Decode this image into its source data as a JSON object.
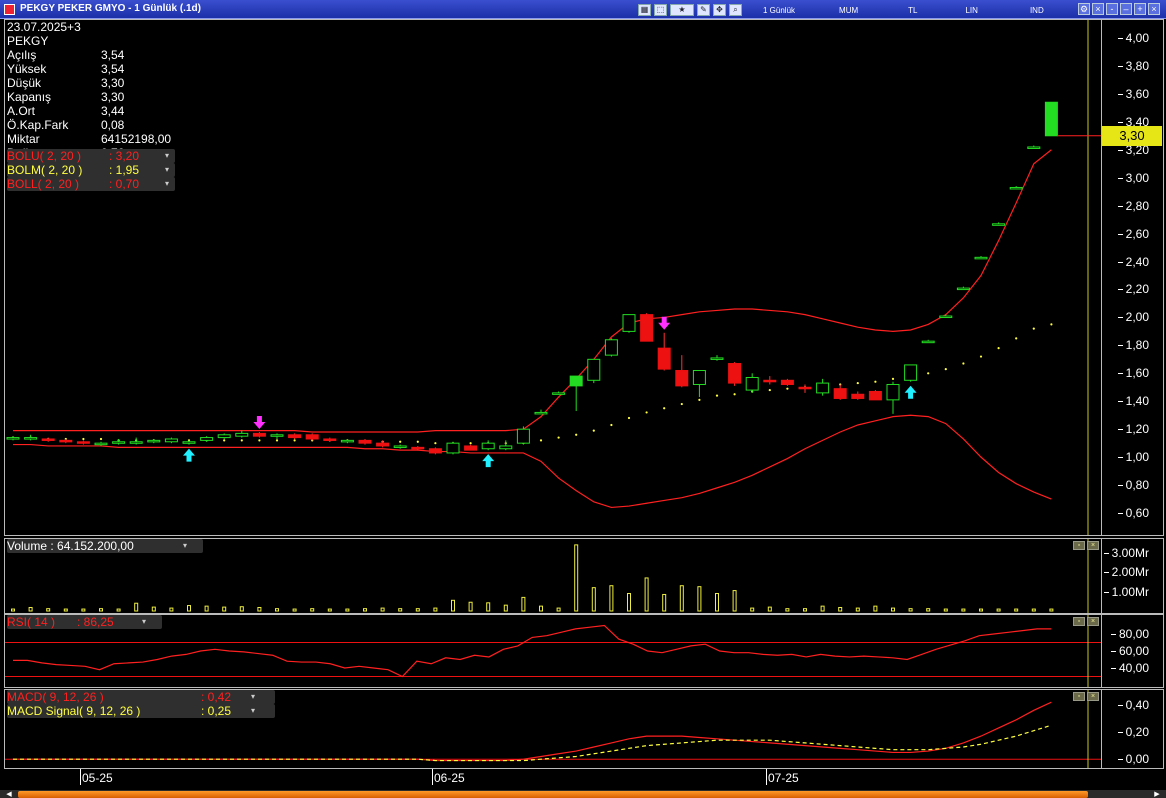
{
  "window": {
    "title": "PEKGY PEKER GMYO - 1 Günlük (.1d)",
    "toolbar": {
      "period_label": "1 Günlük",
      "chart_type": "MUM",
      "currency": "TL",
      "scale": "LIN",
      "indicator": "IND",
      "icons": [
        "toolbar-icon-1",
        "toolbar-icon-2",
        "favorites-icon",
        "draw-icon",
        "cursor-icon",
        "zoom-icon"
      ]
    },
    "buttons": [
      "settings-icon",
      "close-icon",
      "minimize-icon",
      "maximize-icon",
      "restore-icon",
      "close-window-icon"
    ]
  },
  "info": {
    "date": "23.07.2025+3",
    "symbol": "PEKGY",
    "rows": [
      {
        "k": "Açılış",
        "v": "3,54"
      },
      {
        "k": "Yüksek",
        "v": "3,54"
      },
      {
        "k": "Düşük",
        "v": "3,30"
      },
      {
        "k": "Kapanış",
        "v": "3,30"
      },
      {
        "k": "A.Ort",
        "v": "3,44"
      },
      {
        "k": "Ö.Kap.Fark",
        "v": "0,08"
      },
      {
        "k": "Miktar",
        "v": "64152198,00"
      },
      {
        "k": "Değer",
        "v": "0,76"
      }
    ]
  },
  "price_legend": [
    {
      "k": "BOLU( 2, 20 )",
      "v": ": 3,20",
      "color": "#ff2020"
    },
    {
      "k": "BOLM( 2, 20 )",
      "v": ": 1,95",
      "color": "#ffff40"
    },
    {
      "k": "BOLL( 2, 20 )",
      "v": ": 0,70",
      "color": "#ff2020"
    }
  ],
  "price_axis": [
    "4,00",
    "3,80",
    "3,60",
    "3,40",
    "3,20",
    "3,00",
    "2,80",
    "2,60",
    "2,40",
    "2,20",
    "2,00",
    "1,80",
    "1,60",
    "1,40",
    "1,20",
    "1,00",
    "0,80",
    "0,60"
  ],
  "last_price": "3,30",
  "volume": {
    "legend": "Volume : 64.152.200,00",
    "axis": [
      "3.00Mr",
      "2.00Mr",
      "1.00Mr"
    ]
  },
  "rsi": {
    "legend_k": "RSI( 14 )",
    "legend_v": ": 86,25",
    "axis": [
      "80,00",
      "60,00",
      "40,00"
    ]
  },
  "macd": {
    "legend": [
      {
        "k": "MACD( 9, 12, 26 )",
        "v": ": 0,42",
        "color": "#ff2020"
      },
      {
        "k": "MACD Signal( 9, 12, 26 )",
        "v": ": 0,25",
        "color": "#ffff40"
      }
    ],
    "axis": [
      "0,40",
      "0,20",
      "0,00"
    ]
  },
  "date_axis": [
    "05-25",
    "06-25",
    "07-25"
  ],
  "colors": {
    "up": "#22dd22",
    "down": "#ee1111",
    "boll": "#ff2020",
    "mid": "#ffff40",
    "volume": "#eeee40",
    "signal_up": "#20f0ff",
    "signal_down": "#ff30ff"
  },
  "chart_data": {
    "type": "candlestick",
    "candles": [
      {
        "o": 1.13,
        "h": 1.15,
        "l": 1.12,
        "c": 1.14
      },
      {
        "o": 1.13,
        "h": 1.16,
        "l": 1.12,
        "c": 1.14
      },
      {
        "o": 1.13,
        "h": 1.14,
        "l": 1.11,
        "c": 1.12
      },
      {
        "o": 1.12,
        "h": 1.13,
        "l": 1.1,
        "c": 1.11
      },
      {
        "o": 1.11,
        "h": 1.12,
        "l": 1.09,
        "c": 1.1
      },
      {
        "o": 1.09,
        "h": 1.11,
        "l": 1.08,
        "c": 1.1
      },
      {
        "o": 1.1,
        "h": 1.13,
        "l": 1.09,
        "c": 1.11
      },
      {
        "o": 1.1,
        "h": 1.14,
        "l": 1.09,
        "c": 1.11
      },
      {
        "o": 1.11,
        "h": 1.13,
        "l": 1.1,
        "c": 1.12
      },
      {
        "o": 1.11,
        "h": 1.14,
        "l": 1.1,
        "c": 1.13
      },
      {
        "o": 1.1,
        "h": 1.12,
        "l": 1.09,
        "c": 1.11
      },
      {
        "o": 1.12,
        "h": 1.15,
        "l": 1.11,
        "c": 1.14
      },
      {
        "o": 1.14,
        "h": 1.17,
        "l": 1.13,
        "c": 1.16
      },
      {
        "o": 1.15,
        "h": 1.19,
        "l": 1.14,
        "c": 1.17
      },
      {
        "o": 1.17,
        "h": 1.18,
        "l": 1.14,
        "c": 1.15
      },
      {
        "o": 1.15,
        "h": 1.17,
        "l": 1.13,
        "c": 1.16
      },
      {
        "o": 1.16,
        "h": 1.17,
        "l": 1.13,
        "c": 1.14
      },
      {
        "o": 1.16,
        "h": 1.17,
        "l": 1.12,
        "c": 1.13
      },
      {
        "o": 1.13,
        "h": 1.14,
        "l": 1.11,
        "c": 1.12
      },
      {
        "o": 1.11,
        "h": 1.13,
        "l": 1.1,
        "c": 1.12
      },
      {
        "o": 1.12,
        "h": 1.13,
        "l": 1.09,
        "c": 1.1
      },
      {
        "o": 1.1,
        "h": 1.12,
        "l": 1.07,
        "c": 1.08
      },
      {
        "o": 1.07,
        "h": 1.09,
        "l": 1.06,
        "c": 1.08
      },
      {
        "o": 1.07,
        "h": 1.08,
        "l": 1.05,
        "c": 1.06
      },
      {
        "o": 1.06,
        "h": 1.07,
        "l": 1.02,
        "c": 1.03
      },
      {
        "o": 1.03,
        "h": 1.11,
        "l": 1.02,
        "c": 1.1
      },
      {
        "o": 1.08,
        "h": 1.09,
        "l": 1.05,
        "c": 1.05
      },
      {
        "o": 1.06,
        "h": 1.12,
        "l": 1.05,
        "c": 1.1
      },
      {
        "o": 1.06,
        "h": 1.12,
        "l": 1.05,
        "c": 1.08
      },
      {
        "o": 1.1,
        "h": 1.22,
        "l": 1.09,
        "c": 1.2
      },
      {
        "o": 1.32,
        "h": 1.34,
        "l": 1.31,
        "c": 1.32
      },
      {
        "o": 1.46,
        "h": 1.47,
        "l": 1.45,
        "c": 1.46
      },
      {
        "o": 1.51,
        "h": 1.58,
        "l": 1.33,
        "c": 1.58
      },
      {
        "o": 1.55,
        "h": 1.7,
        "l": 1.53,
        "c": 1.7
      },
      {
        "o": 1.73,
        "h": 1.85,
        "l": 1.72,
        "c": 1.84
      },
      {
        "o": 1.9,
        "h": 2.02,
        "l": 1.89,
        "c": 2.02
      },
      {
        "o": 2.02,
        "h": 2.03,
        "l": 1.84,
        "c": 1.83
      },
      {
        "o": 1.78,
        "h": 1.89,
        "l": 1.62,
        "c": 1.63
      },
      {
        "o": 1.62,
        "h": 1.73,
        "l": 1.5,
        "c": 1.51
      },
      {
        "o": 1.52,
        "h": 1.62,
        "l": 1.43,
        "c": 1.62
      },
      {
        "o": 1.7,
        "h": 1.73,
        "l": 1.69,
        "c": 1.71
      },
      {
        "o": 1.67,
        "h": 1.68,
        "l": 1.51,
        "c": 1.53
      },
      {
        "o": 1.48,
        "h": 1.6,
        "l": 1.46,
        "c": 1.57
      },
      {
        "o": 1.55,
        "h": 1.58,
        "l": 1.52,
        "c": 1.54
      },
      {
        "o": 1.55,
        "h": 1.56,
        "l": 1.51,
        "c": 1.52
      },
      {
        "o": 1.5,
        "h": 1.52,
        "l": 1.46,
        "c": 1.49
      },
      {
        "o": 1.46,
        "h": 1.56,
        "l": 1.44,
        "c": 1.53
      },
      {
        "o": 1.49,
        "h": 1.52,
        "l": 1.41,
        "c": 1.42
      },
      {
        "o": 1.45,
        "h": 1.47,
        "l": 1.41,
        "c": 1.42
      },
      {
        "o": 1.47,
        "h": 1.48,
        "l": 1.41,
        "c": 1.41
      },
      {
        "o": 1.41,
        "h": 1.54,
        "l": 1.31,
        "c": 1.52
      },
      {
        "o": 1.55,
        "h": 1.66,
        "l": 1.54,
        "c": 1.66
      },
      {
        "o": 1.83,
        "h": 1.84,
        "l": 1.82,
        "c": 1.83
      },
      {
        "o": 2.01,
        "h": 2.02,
        "l": 2.0,
        "c": 2.01
      },
      {
        "o": 2.21,
        "h": 2.22,
        "l": 2.2,
        "c": 2.21
      },
      {
        "o": 2.43,
        "h": 2.44,
        "l": 2.42,
        "c": 2.43
      },
      {
        "o": 2.67,
        "h": 2.68,
        "l": 2.66,
        "c": 2.67
      },
      {
        "o": 2.93,
        "h": 2.94,
        "l": 2.92,
        "c": 2.93
      },
      {
        "o": 3.22,
        "h": 3.23,
        "l": 3.21,
        "c": 3.22
      },
      {
        "o": 3.3,
        "h": 3.54,
        "l": 3.3,
        "c": 3.54
      }
    ],
    "boll_upper": [
      1.19,
      1.19,
      1.19,
      1.19,
      1.19,
      1.19,
      1.19,
      1.19,
      1.19,
      1.19,
      1.19,
      1.19,
      1.19,
      1.19,
      1.19,
      1.19,
      1.19,
      1.18,
      1.18,
      1.18,
      1.18,
      1.18,
      1.18,
      1.18,
      1.19,
      1.19,
      1.19,
      1.19,
      1.19,
      1.2,
      1.29,
      1.43,
      1.56,
      1.7,
      1.86,
      1.96,
      1.99,
      2.0,
      2.02,
      2.04,
      2.05,
      2.06,
      2.06,
      2.05,
      2.04,
      2.02,
      1.99,
      1.96,
      1.93,
      1.91,
      1.9,
      1.91,
      1.95,
      2.02,
      2.14,
      2.3,
      2.55,
      2.82,
      3.1,
      3.2
    ],
    "boll_mid": [
      1.14,
      1.14,
      1.13,
      1.13,
      1.13,
      1.13,
      1.12,
      1.12,
      1.12,
      1.12,
      1.12,
      1.12,
      1.12,
      1.12,
      1.12,
      1.12,
      1.12,
      1.12,
      1.12,
      1.12,
      1.11,
      1.11,
      1.11,
      1.11,
      1.1,
      1.1,
      1.1,
      1.1,
      1.1,
      1.1,
      1.12,
      1.14,
      1.16,
      1.19,
      1.23,
      1.28,
      1.32,
      1.35,
      1.38,
      1.41,
      1.44,
      1.45,
      1.47,
      1.48,
      1.49,
      1.5,
      1.51,
      1.52,
      1.53,
      1.54,
      1.56,
      1.58,
      1.6,
      1.63,
      1.67,
      1.72,
      1.78,
      1.85,
      1.92,
      1.95
    ],
    "boll_lower": [
      1.09,
      1.09,
      1.08,
      1.08,
      1.08,
      1.08,
      1.07,
      1.07,
      1.07,
      1.07,
      1.07,
      1.07,
      1.07,
      1.07,
      1.07,
      1.07,
      1.07,
      1.07,
      1.07,
      1.07,
      1.06,
      1.06,
      1.05,
      1.05,
      1.04,
      1.04,
      1.03,
      1.03,
      1.03,
      1.03,
      0.97,
      0.85,
      0.76,
      0.68,
      0.64,
      0.65,
      0.67,
      0.69,
      0.71,
      0.74,
      0.78,
      0.82,
      0.87,
      0.93,
      0.99,
      1.06,
      1.12,
      1.18,
      1.23,
      1.26,
      1.29,
      1.3,
      1.29,
      1.24,
      1.13,
      1.0,
      0.89,
      0.81,
      0.75,
      0.7
    ],
    "signals": [
      {
        "i": 14,
        "dir": "down"
      },
      {
        "i": 10,
        "dir": "up"
      },
      {
        "i": 27,
        "dir": "up"
      },
      {
        "i": 37,
        "dir": "down"
      },
      {
        "i": 51,
        "dir": "up"
      }
    ],
    "volume": [
      0.1,
      0.18,
      0.12,
      0.1,
      0.1,
      0.12,
      0.1,
      0.4,
      0.2,
      0.15,
      0.28,
      0.25,
      0.2,
      0.22,
      0.18,
      0.12,
      0.1,
      0.12,
      0.1,
      0.1,
      0.12,
      0.15,
      0.12,
      0.12,
      0.15,
      0.55,
      0.45,
      0.42,
      0.3,
      0.7,
      0.25,
      0.15,
      3.4,
      1.2,
      1.3,
      0.9,
      1.7,
      0.85,
      1.3,
      1.25,
      0.9,
      1.05,
      0.15,
      0.2,
      0.12,
      0.12,
      0.25,
      0.18,
      0.15,
      0.25,
      0.15,
      0.12,
      0.12,
      0.1,
      0.1,
      0.1,
      0.1,
      0.1,
      0.1,
      0.1
    ],
    "rsi": [
      49,
      49,
      46,
      44,
      43,
      42,
      38,
      45,
      46,
      47,
      50,
      54,
      56,
      60,
      62,
      60,
      59,
      57,
      55,
      48,
      47,
      47,
      45,
      40,
      42,
      40,
      38,
      30,
      48,
      45,
      52,
      50,
      55,
      53,
      62,
      66,
      76,
      78,
      82,
      86,
      88,
      90,
      74,
      68,
      60,
      58,
      62,
      66,
      68,
      60,
      58,
      58,
      56,
      55,
      56,
      53,
      56,
      54,
      53,
      54,
      53,
      52,
      50,
      56,
      62,
      67,
      72,
      78,
      80,
      82,
      84,
      86,
      86
    ],
    "macd": [
      0.0,
      0.0,
      0.0,
      0.0,
      0.0,
      0.0,
      0.0,
      0.0,
      0.0,
      0.0,
      0.0,
      0.0,
      0.0,
      0.0,
      0.0,
      0.0,
      0.0,
      0.0,
      0.0,
      0.0,
      0.0,
      0.0,
      0.0,
      0.0,
      -0.01,
      -0.01,
      -0.01,
      -0.01,
      -0.01,
      0.0,
      0.02,
      0.04,
      0.06,
      0.09,
      0.12,
      0.15,
      0.17,
      0.17,
      0.17,
      0.16,
      0.15,
      0.14,
      0.13,
      0.12,
      0.11,
      0.1,
      0.09,
      0.08,
      0.07,
      0.06,
      0.05,
      0.05,
      0.06,
      0.08,
      0.12,
      0.17,
      0.23,
      0.29,
      0.36,
      0.42
    ],
    "macd_signal": [
      0.0,
      0.0,
      0.0,
      0.0,
      0.0,
      0.0,
      0.0,
      0.0,
      0.0,
      0.0,
      0.0,
      0.0,
      0.0,
      0.0,
      0.0,
      0.0,
      0.0,
      0.0,
      0.0,
      0.0,
      0.0,
      0.0,
      0.0,
      0.0,
      -0.01,
      -0.01,
      -0.01,
      -0.01,
      -0.01,
      -0.01,
      0.0,
      0.01,
      0.02,
      0.04,
      0.06,
      0.08,
      0.1,
      0.11,
      0.12,
      0.13,
      0.14,
      0.14,
      0.14,
      0.14,
      0.13,
      0.12,
      0.11,
      0.1,
      0.09,
      0.08,
      0.07,
      0.07,
      0.07,
      0.08,
      0.09,
      0.11,
      0.14,
      0.17,
      0.21,
      0.25
    ],
    "price_range": [
      0.5,
      4.1
    ],
    "volume_range": [
      0,
      3.6
    ],
    "rsi_range": [
      20,
      100
    ],
    "rsi_levels": [
      70,
      30
    ],
    "macd_range": [
      -0.05,
      0.48
    ]
  }
}
